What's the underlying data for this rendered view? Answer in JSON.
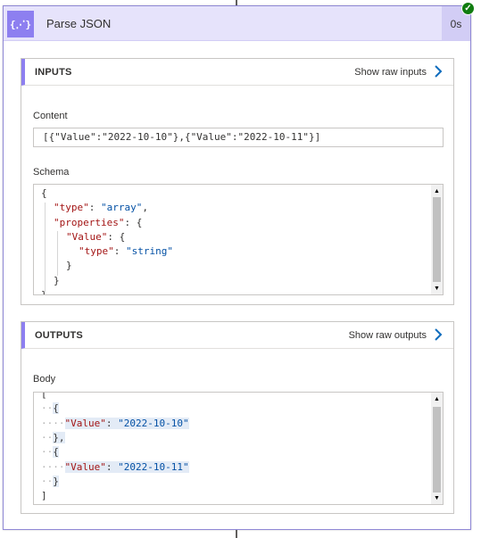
{
  "action": {
    "icon": "{⋰}",
    "title": "Parse JSON",
    "duration": "0s",
    "status_icon": "check-circle-icon"
  },
  "inputs": {
    "section_title": "INPUTS",
    "raw_link": "Show raw inputs",
    "content_label": "Content",
    "content_value": "[{\"Value\":\"2022-10-10\"},{\"Value\":\"2022-10-11\"}]",
    "schema_label": "Schema",
    "schema_lines": [
      "{",
      "\"type\": \"array\",",
      "\"properties\": {",
      "\"Value\": {",
      "\"type\": \"string\"",
      "}",
      "}",
      "}"
    ]
  },
  "outputs": {
    "section_title": "OUTPUTS",
    "raw_link": "Show raw outputs",
    "body_label": "Body",
    "body_lines": [
      "[",
      "{",
      "\"Value\": \"2022-10-10\"",
      "},",
      "{",
      "\"Value\": \"2022-10-11\"",
      "}",
      "]"
    ]
  },
  "colors": {
    "accent": "#8d7ff0",
    "header_bg": "#e6e3fb",
    "success": "#107c10",
    "json_key": "#a31515",
    "json_string": "#0451a5"
  }
}
